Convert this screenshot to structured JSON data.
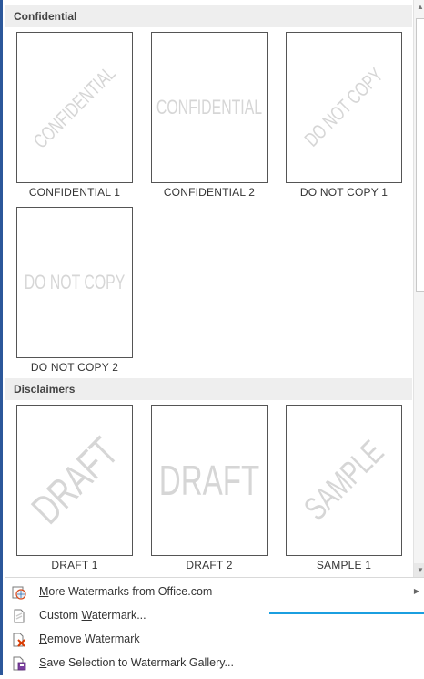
{
  "sections": [
    {
      "title": "Confidential",
      "items": [
        {
          "caption": "CONFIDENTIAL 1",
          "watermark": "CONFIDENTIAL",
          "style": "diag-sm"
        },
        {
          "caption": "CONFIDENTIAL 2",
          "watermark": "CONFIDENTIAL",
          "style": "horiz-sm"
        },
        {
          "caption": "DO NOT COPY 1",
          "watermark": "DO NOT COPY",
          "style": "diag-sm"
        },
        {
          "caption": "DO NOT COPY 2",
          "watermark": "DO NOT COPY",
          "style": "horiz-sm"
        }
      ]
    },
    {
      "title": "Disclaimers",
      "items": [
        {
          "caption": "DRAFT 1",
          "watermark": "DRAFT",
          "style": "diag-lg"
        },
        {
          "caption": "DRAFT 2",
          "watermark": "DRAFT",
          "style": "horiz-lg"
        },
        {
          "caption": "SAMPLE 1",
          "watermark": "SAMPLE",
          "style": "diag-md"
        }
      ]
    }
  ],
  "menu": {
    "items": [
      {
        "label": "More Watermarks from Office.com",
        "icon": "office-globe-icon",
        "has_submenu": true
      },
      {
        "label": "Custom Watermark...",
        "icon": "document-icon",
        "has_submenu": false
      },
      {
        "label": "Remove Watermark",
        "icon": "remove-watermark-icon",
        "has_submenu": false
      },
      {
        "label": "Save Selection to Watermark Gallery...",
        "icon": "save-to-gallery-icon",
        "has_submenu": false
      }
    ]
  },
  "colors": {
    "window_border": "#2b579a",
    "header_bg": "#eeeeee",
    "watermark_text": "#d6d6d6",
    "accent_line": "#1b9fe0",
    "remove_icon_red": "#d83b01"
  },
  "scrollbar": {
    "up_icon": "scroll-up-arrow-icon",
    "down_icon": "scroll-down-arrow-icon"
  }
}
